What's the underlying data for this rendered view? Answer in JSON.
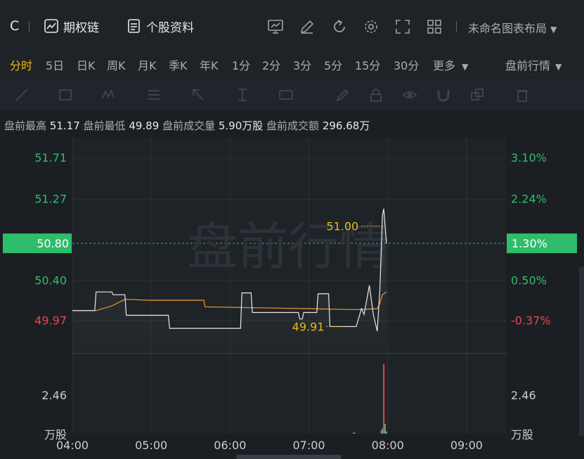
{
  "header": {
    "ticker": "C",
    "options_chain": "期权链",
    "stock_info": "个股资料",
    "layout_name": "未命名图表布局"
  },
  "periods": {
    "items": [
      "分时",
      "5日",
      "日K",
      "周K",
      "月K",
      "季K",
      "年K",
      "1分",
      "2分",
      "3分",
      "5分",
      "15分",
      "30分",
      "更多"
    ],
    "active": "分时",
    "session": "盘前行情"
  },
  "stats": {
    "high_label": "盘前最高",
    "high": "51.17",
    "low_label": "盘前最低",
    "low": "49.89",
    "volume_label": "盘前成交量",
    "volume": "5.90万股",
    "turnover_label": "盘前成交额",
    "turnover": "296.68万"
  },
  "colors": {
    "up": "#2ebd6b",
    "down": "#e5484d",
    "price_line": "#e8e8e8",
    "avg_line": "#e0902a",
    "highlight": "#f0b90b",
    "current_tag": "#2ebd6b"
  },
  "chart_data": {
    "type": "line",
    "watermark": "盘前行情",
    "x_ticks": [
      "04:00",
      "05:00",
      "06:00",
      "07:00",
      "08:00",
      "09:00"
    ],
    "x_range": [
      "04:00",
      "09:30"
    ],
    "price_axis": {
      "left_ticks": [
        "51.71",
        "51.27",
        "50.40",
        "49.97"
      ],
      "right_ticks": [
        "3.10%",
        "2.24%",
        "0.50%",
        "-0.37%"
      ],
      "current_price": "50.80",
      "current_pct": "1.30%",
      "range": [
        49.62,
        51.93
      ],
      "prev_close": 50.15
    },
    "volume_axis": {
      "max_label": "2.46",
      "unit": "万股",
      "max": 2.46
    },
    "annotations": {
      "high": "51.00",
      "low": "49.91"
    },
    "price_series": {
      "name": "price",
      "points": [
        [
          "04:00",
          50.08
        ],
        [
          "04:17",
          50.08
        ],
        [
          "04:18",
          50.28
        ],
        [
          "04:30",
          50.28
        ],
        [
          "04:31",
          50.25
        ],
        [
          "04:40",
          50.25
        ],
        [
          "04:41",
          50.03
        ],
        [
          "05:13",
          50.03
        ],
        [
          "05:14",
          49.89
        ],
        [
          "06:08",
          49.89
        ],
        [
          "06:09",
          50.27
        ],
        [
          "06:16",
          50.27
        ],
        [
          "06:17",
          50.06
        ],
        [
          "06:52",
          50.06
        ],
        [
          "06:53",
          49.99
        ],
        [
          "06:55",
          49.99
        ],
        [
          "06:56",
          50.06
        ],
        [
          "07:06",
          50.06
        ],
        [
          "07:07",
          50.26
        ],
        [
          "07:15",
          50.26
        ],
        [
          "07:16",
          49.91
        ],
        [
          "07:36",
          49.91
        ],
        [
          "07:40",
          50.1
        ],
        [
          "07:42",
          50.04
        ],
        [
          "07:46",
          50.35
        ],
        [
          "07:49",
          50.04
        ],
        [
          "07:52",
          49.86
        ],
        [
          "07:54",
          50.3
        ],
        [
          "07:56",
          51.1
        ],
        [
          "07:57",
          51.17
        ],
        [
          "07:59",
          50.8
        ]
      ]
    },
    "avg_series": {
      "name": "average",
      "points": [
        [
          "04:00",
          50.08
        ],
        [
          "04:18",
          50.08
        ],
        [
          "04:30",
          50.13
        ],
        [
          "04:40",
          50.2
        ],
        [
          "05:00",
          50.19
        ],
        [
          "05:40",
          50.19
        ],
        [
          "05:41",
          50.12
        ],
        [
          "07:00",
          50.1
        ],
        [
          "07:36",
          50.09
        ],
        [
          "07:52",
          50.1
        ],
        [
          "07:54",
          50.16
        ],
        [
          "07:56",
          50.25
        ],
        [
          "07:59",
          50.28
        ]
      ]
    },
    "volume_series": {
      "name": "volume",
      "bars": [
        [
          "07:34",
          0.04,
          "up"
        ],
        [
          "07:35",
          0.03,
          "up"
        ],
        [
          "07:55",
          0.12,
          "down"
        ],
        [
          "07:56",
          0.18,
          "up"
        ],
        [
          "07:57",
          2.46,
          "down"
        ],
        [
          "07:58",
          0.35,
          "up"
        ],
        [
          "07:59",
          0.08,
          "up"
        ]
      ]
    }
  }
}
